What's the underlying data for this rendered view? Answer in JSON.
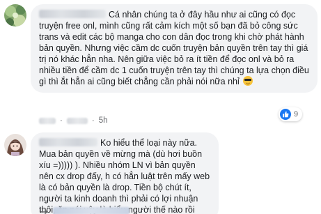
{
  "comments": [
    {
      "text": "Cá nhân chúng ta ở đây hầu như ai cũng có đọc truyện free onl, mình cũng rất cảm kích một số bạn đã bỏ công sức trans và edit các bộ manga cho con dân đọc trong khi chờ phát hành bản quyền. Nhưng việc cầm dc cuốn truyện bản quyền trên tay thì giá trị nó khác hẳn nha. Nên giữa việc bỏ ra ít tiền để đọc onl và bỏ ra nhiều tiền để cầm dc 1 cuốn truyện trên tay thì chúng ta lựa chọn điều gì thì ắt hẳn ai cũng biết chẳng cần phải nói nữa nhỉ",
      "emoji": "sunglasses-emoji",
      "time": "5h",
      "reaction_count": "9",
      "reaction_icon": "like-icon"
    },
    {
      "text": "Ko hiểu thể loại này nữa. Mua bản quyền về mừng mà (dù hơi buồn xíu =))))) ). Nhiều nhóm LN vì bản quyền nên cx drop đấy, h có hẳn luật trên mấy web là có bản quyền là drop. Tiền bộ chút ít, người ta kinh doanh thì phải có lợi nhuận thôi, ăn nói vậy là hiểu người thế nào rồi"
    }
  ],
  "colors": {
    "bubble_bg": "#f2f3f5",
    "link_blue": "#385898",
    "like_blue": "#1877f2"
  }
}
